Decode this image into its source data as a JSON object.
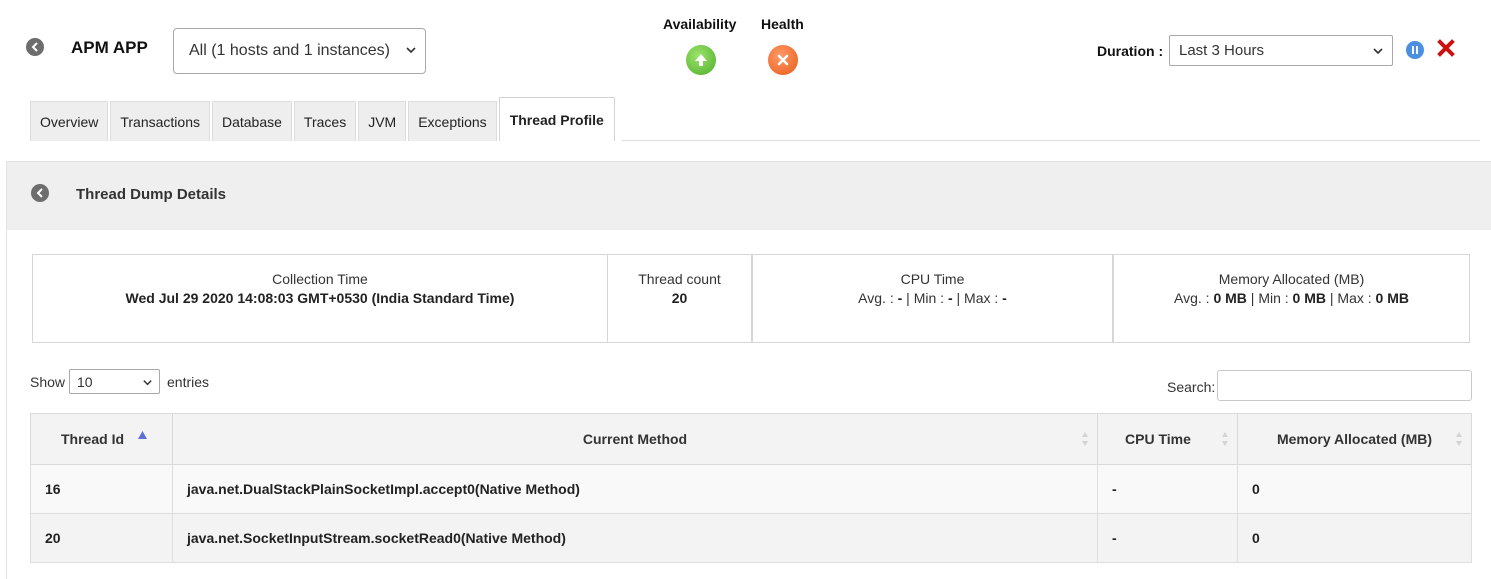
{
  "header": {
    "app_title": "APM APP",
    "host_select": "All (1 hosts and 1 instances)",
    "availability_label": "Availability",
    "health_label": "Health",
    "availability_status": "up",
    "health_status": "critical",
    "duration_label": "Duration :",
    "duration_value": "Last 3 Hours"
  },
  "tabs": [
    {
      "label": "Overview"
    },
    {
      "label": "Transactions"
    },
    {
      "label": "Database"
    },
    {
      "label": "Traces"
    },
    {
      "label": "JVM"
    },
    {
      "label": "Exceptions"
    },
    {
      "label": "Thread Profile",
      "active": true
    }
  ],
  "panel": {
    "title": "Thread Dump Details"
  },
  "summary": {
    "collection_time_label": "Collection Time",
    "collection_time_value": "Wed Jul 29 2020 14:08:03 GMT+0530 (India Standard Time)",
    "thread_count_label": "Thread count",
    "thread_count_value": "20",
    "cpu_time_label": "CPU Time",
    "cpu_avg_label": "Avg. :",
    "cpu_avg": "-",
    "cpu_min_label": "Min :",
    "cpu_min": "-",
    "cpu_max_label": "Max :",
    "cpu_max": "-",
    "memory_label": "Memory Allocated (MB)",
    "mem_avg_label": "Avg. :",
    "mem_avg": "0 MB",
    "mem_min_label": "Min :",
    "mem_min": "0 MB",
    "mem_max_label": "Max :",
    "mem_max": "0 MB",
    "separator": "|"
  },
  "table_controls": {
    "show_label": "Show",
    "entries_value": "10",
    "entries_label": "entries",
    "search_label": "Search:"
  },
  "table": {
    "columns": [
      "Thread Id",
      "Current Method",
      "CPU Time",
      "Memory Allocated (MB)"
    ],
    "rows": [
      [
        "16",
        "java.net.DualStackPlainSocketImpl.accept0(Native Method)",
        "-",
        "0"
      ],
      [
        "20",
        "java.net.SocketInputStream.socketRead0(Native Method)",
        "-",
        "0"
      ]
    ]
  },
  "colors": {
    "availability_green": "#4fae2a",
    "health_orange": "#e85a1a",
    "pause_blue": "#4a8fe0",
    "close_red": "#cc1111",
    "sort_active": "#5b6fd6"
  }
}
